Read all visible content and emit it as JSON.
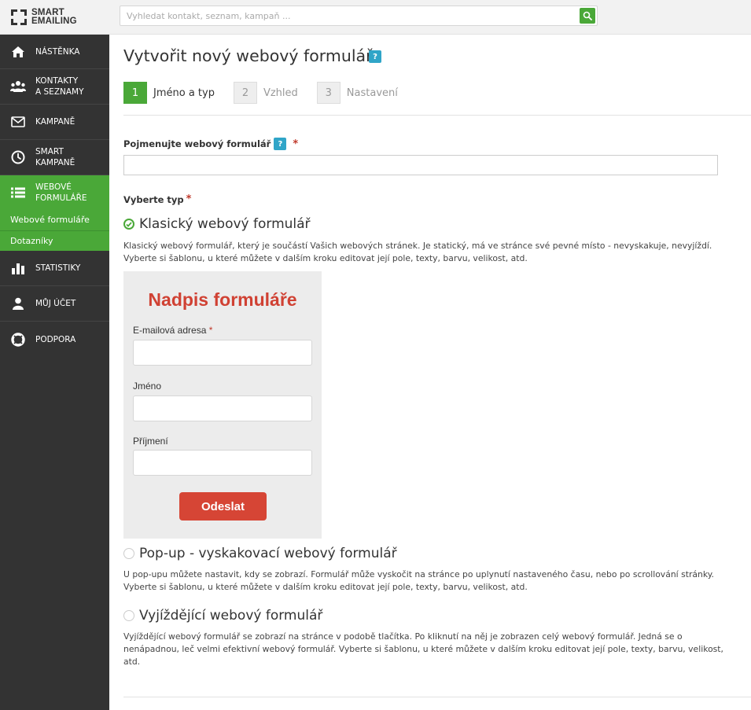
{
  "app": {
    "logo_line1": "SMART",
    "logo_line2": "EMAILING"
  },
  "search": {
    "placeholder": "Vyhledat kontakt, seznam, kampaň ..."
  },
  "sidebar": {
    "items": [
      {
        "label": "NÁSTĚNKA",
        "icon": "home-icon"
      },
      {
        "label": "KONTAKTY\nA SEZNAMY",
        "icon": "users-icon"
      },
      {
        "label": "KAMPANĚ",
        "icon": "envelope-icon"
      },
      {
        "label": "SMART\nKAMPANĚ",
        "icon": "clock-icon"
      },
      {
        "label": "WEBOVÉ\nFORMULÁŘE",
        "icon": "list-icon",
        "active": true
      },
      {
        "label": "STATISTIKY",
        "icon": "bar-chart-icon"
      },
      {
        "label": "MŮJ ÚČET",
        "icon": "user-icon"
      },
      {
        "label": "PODPORA",
        "icon": "lifebuoy-icon"
      }
    ],
    "subitems": [
      "Webové formuláře",
      "Dotazníky"
    ]
  },
  "main": {
    "title": "Vytvořit nový webový formulář",
    "help_label": "?",
    "steps": [
      {
        "num": "1",
        "label": "Jméno a typ",
        "active": true
      },
      {
        "num": "2",
        "label": "Vzhled",
        "active": false
      },
      {
        "num": "3",
        "label": "Nastavení",
        "active": false
      }
    ],
    "name_label": "Pojmenujte webový formulář",
    "name_value": "",
    "type_label": "Vyberte typ",
    "required_mark": "*",
    "types": [
      {
        "title": "Klasický webový formulář",
        "checked": true,
        "description": "Klasický webový formulář, který je součástí Vašich webových stránek. Je statický, má ve stránce své pevné místo - nevyskakuje, nevyjíždí. Vyberte si šablonu, u které můžete v dalším kroku editovat její pole, texty, barvu, velikost, atd."
      },
      {
        "title": "Pop-up - vyskakovací webový formulář",
        "checked": false,
        "description": "U pop-upu můžete nastavit, kdy se zobrazí. Formulář může vyskočit na stránce po uplynutí nastaveného času, nebo po scrollování stránky. Vyberte si šablonu, u které můžete v dalším kroku editovat její pole, texty, barvu, velikost, atd."
      },
      {
        "title": "Vyjíždějící webový formulář",
        "checked": false,
        "description": "Vyjíždějící webový formulář se zobrazí na stránce v podobě tlačítka. Po kliknutí na něj je zobrazen celý webový formulář. Jedná se o nenápadnou, leč velmi efektivní webový formulář. Vyberte si šablonu, u které můžete v dalším kroku editovat její pole, texty, barvu, velikost, atd."
      }
    ]
  },
  "preview": {
    "title": "Nadpis formuláře",
    "email_label": "E-mailová adresa",
    "required_mark": "*",
    "first_name_label": "Jméno",
    "last_name_label": "Příjmení",
    "submit_label": "Odeslat"
  },
  "colors": {
    "brand_green": "#4aa838",
    "sidebar_bg": "#333333",
    "help_blue": "#30a5c8",
    "accent_red": "#d04133"
  }
}
